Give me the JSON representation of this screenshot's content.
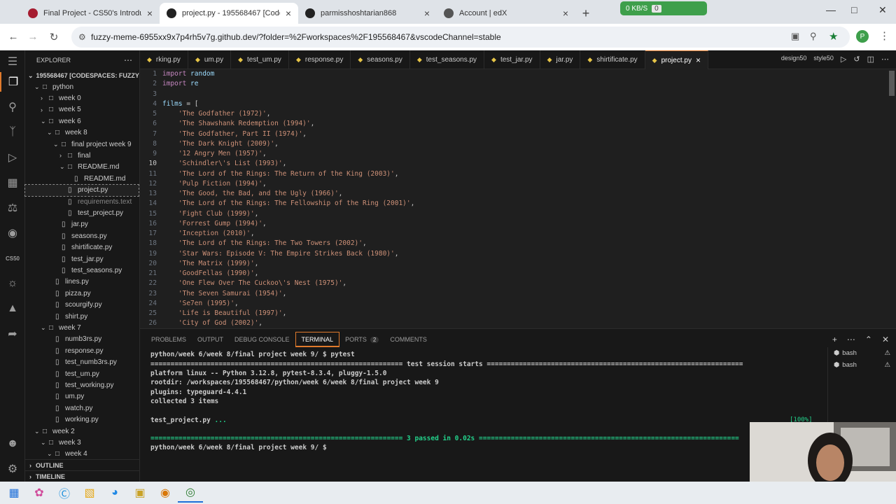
{
  "browser": {
    "tabs": [
      {
        "title": "Final Project - CS50's Introducti",
        "color": "#a51c30",
        "active": false
      },
      {
        "title": "project.py - 195568467 [Codesp",
        "color": "#222222",
        "active": true
      },
      {
        "title": "parmisshoshtarian868",
        "color": "#222222",
        "active": false
      },
      {
        "title": "Account | edX",
        "color": "#555555",
        "active": false
      }
    ],
    "net_speed": "0 KB/S",
    "net_count": "0",
    "url": "fuzzy-meme-6955xx9x7p4rh5v7g.github.dev/?folder=%2Fworkspaces%2F195568467&vscodeChannel=stable",
    "profile_initial": "P"
  },
  "activity": {
    "cs50_label": "CS50"
  },
  "explorer": {
    "title": "EXPLORER",
    "root": "195568467 [CODESPACES: FUZZY M...",
    "outline": "OUTLINE",
    "timeline": "TIMELINE",
    "tree": [
      {
        "label": "python",
        "type": "folder",
        "open": true,
        "indent": 1
      },
      {
        "label": "week 0",
        "type": "folder",
        "open": false,
        "indent": 2
      },
      {
        "label": "week 5",
        "type": "folder",
        "open": false,
        "indent": 2
      },
      {
        "label": "week 6",
        "type": "folder",
        "open": true,
        "indent": 2
      },
      {
        "label": "week 8",
        "type": "folder",
        "open": true,
        "indent": 3
      },
      {
        "label": "final project week 9",
        "type": "folder",
        "open": true,
        "indent": 4
      },
      {
        "label": "final",
        "type": "folder",
        "open": false,
        "indent": 5
      },
      {
        "label": "README.md",
        "type": "folder",
        "open": true,
        "indent": 5
      },
      {
        "label": "README.md",
        "type": "file",
        "indent": 6
      },
      {
        "label": "project.py",
        "type": "file",
        "indent": 5,
        "selected": true
      },
      {
        "label": "requirements.text",
        "type": "file",
        "indent": 5,
        "dim": true
      },
      {
        "label": "test_project.py",
        "type": "file",
        "indent": 5
      },
      {
        "label": "jar.py",
        "type": "file",
        "indent": 4
      },
      {
        "label": "seasons.py",
        "type": "file",
        "indent": 4
      },
      {
        "label": "shirtificate.py",
        "type": "file",
        "indent": 4
      },
      {
        "label": "test_jar.py",
        "type": "file",
        "indent": 4
      },
      {
        "label": "test_seasons.py",
        "type": "file",
        "indent": 4
      },
      {
        "label": "lines.py",
        "type": "file",
        "indent": 3
      },
      {
        "label": "pizza.py",
        "type": "file",
        "indent": 3
      },
      {
        "label": "scourgify.py",
        "type": "file",
        "indent": 3
      },
      {
        "label": "shirt.py",
        "type": "file",
        "indent": 3
      },
      {
        "label": "week 7",
        "type": "folder",
        "open": true,
        "indent": 2
      },
      {
        "label": "numb3rs.py",
        "type": "file",
        "indent": 3
      },
      {
        "label": "response.py",
        "type": "file",
        "indent": 3
      },
      {
        "label": "test_numb3rs.py",
        "type": "file",
        "indent": 3
      },
      {
        "label": "test_um.py",
        "type": "file",
        "indent": 3
      },
      {
        "label": "test_working.py",
        "type": "file",
        "indent": 3
      },
      {
        "label": "um.py",
        "type": "file",
        "indent": 3
      },
      {
        "label": "watch.py",
        "type": "file",
        "indent": 3
      },
      {
        "label": "working.py",
        "type": "file",
        "indent": 3
      },
      {
        "label": "week 2",
        "type": "folder",
        "open": true,
        "indent": 1
      },
      {
        "label": "week 3",
        "type": "folder",
        "open": true,
        "indent": 2
      },
      {
        "label": "week 4",
        "type": "folder",
        "open": true,
        "indent": 3
      }
    ]
  },
  "editor_tabs": [
    {
      "label": "rking.py",
      "active": false
    },
    {
      "label": "um.py",
      "active": false
    },
    {
      "label": "test_um.py",
      "active": false
    },
    {
      "label": "response.py",
      "active": false
    },
    {
      "label": "seasons.py",
      "active": false
    },
    {
      "label": "test_seasons.py",
      "active": false
    },
    {
      "label": "test_jar.py",
      "active": false
    },
    {
      "label": "jar.py",
      "active": false
    },
    {
      "label": "shirtificate.py",
      "active": false
    },
    {
      "label": "project.py",
      "active": true
    }
  ],
  "editor_tools": [
    "design50",
    "style50"
  ],
  "code": [
    {
      "n": "1",
      "tokens": [
        {
          "t": "import",
          "c": "kw"
        },
        {
          "t": " random",
          "c": "tx"
        }
      ]
    },
    {
      "n": "2",
      "tokens": [
        {
          "t": "import",
          "c": "kw"
        },
        {
          "t": " re",
          "c": "tx"
        }
      ]
    },
    {
      "n": "3",
      "tokens": []
    },
    {
      "n": "4",
      "tokens": [
        {
          "t": "films",
          "c": "tx"
        },
        {
          "t": " = [",
          "c": "pu"
        }
      ]
    },
    {
      "n": "5",
      "tokens": [
        {
          "t": "    'The Godfather (1972)'",
          "c": "st"
        },
        {
          "t": ",",
          "c": "pu"
        }
      ]
    },
    {
      "n": "6",
      "tokens": [
        {
          "t": "    'The Shawshank Redemption (1994)'",
          "c": "st"
        },
        {
          "t": ",",
          "c": "pu"
        }
      ]
    },
    {
      "n": "7",
      "tokens": [
        {
          "t": "    'The Godfather, Part II (1974)'",
          "c": "st"
        },
        {
          "t": ",",
          "c": "pu"
        }
      ]
    },
    {
      "n": "8",
      "tokens": [
        {
          "t": "    'The Dark Knight (2009)'",
          "c": "st"
        },
        {
          "t": ",",
          "c": "pu"
        }
      ]
    },
    {
      "n": "9",
      "tokens": [
        {
          "t": "    '12 Angry Men (1957)'",
          "c": "st"
        },
        {
          "t": ",",
          "c": "pu"
        }
      ]
    },
    {
      "n": "10",
      "cur": true,
      "tokens": [
        {
          "t": "    'Schindler\\'s List (1993)'",
          "c": "st"
        },
        {
          "t": ",",
          "c": "pu"
        }
      ]
    },
    {
      "n": "11",
      "tokens": [
        {
          "t": "    'The Lord of the Rings: The Return of the King (2003)'",
          "c": "st"
        },
        {
          "t": ",",
          "c": "pu"
        }
      ]
    },
    {
      "n": "12",
      "tokens": [
        {
          "t": "    'Pulp Fiction (1994)'",
          "c": "st"
        },
        {
          "t": ",",
          "c": "pu"
        }
      ]
    },
    {
      "n": "13",
      "tokens": [
        {
          "t": "    'The Good, the Bad, and the Ugly (1966)'",
          "c": "st"
        },
        {
          "t": ",",
          "c": "pu"
        }
      ]
    },
    {
      "n": "14",
      "tokens": [
        {
          "t": "    'The Lord of the Rings: The Fellowship of the Ring (2001)'",
          "c": "st"
        },
        {
          "t": ",",
          "c": "pu"
        }
      ]
    },
    {
      "n": "15",
      "tokens": [
        {
          "t": "    'Fight Club (1999)'",
          "c": "st"
        },
        {
          "t": ",",
          "c": "pu"
        }
      ]
    },
    {
      "n": "16",
      "tokens": [
        {
          "t": "    'Forrest Gump (1994)'",
          "c": "st"
        },
        {
          "t": ",",
          "c": "pu"
        }
      ]
    },
    {
      "n": "17",
      "tokens": [
        {
          "t": "    'Inception (2010)'",
          "c": "st"
        },
        {
          "t": ",",
          "c": "pu"
        }
      ]
    },
    {
      "n": "18",
      "tokens": [
        {
          "t": "    'The Lord of the Rings: The Two Towers (2002)'",
          "c": "st"
        },
        {
          "t": ",",
          "c": "pu"
        }
      ]
    },
    {
      "n": "19",
      "tokens": [
        {
          "t": "    'Star Wars: Episode V: The Empire Strikes Back (1980)'",
          "c": "st"
        },
        {
          "t": ",",
          "c": "pu"
        }
      ]
    },
    {
      "n": "20",
      "tokens": [
        {
          "t": "    'The Matrix (1999)'",
          "c": "st"
        },
        {
          "t": ",",
          "c": "pu"
        }
      ]
    },
    {
      "n": "21",
      "tokens": [
        {
          "t": "    'GoodFellas (1990)'",
          "c": "st"
        },
        {
          "t": ",",
          "c": "pu"
        }
      ]
    },
    {
      "n": "22",
      "tokens": [
        {
          "t": "    'One Flew Over The Cuckoo\\'s Nest (1975)'",
          "c": "st"
        },
        {
          "t": ",",
          "c": "pu"
        }
      ]
    },
    {
      "n": "23",
      "tokens": [
        {
          "t": "    'The Seven Samurai (1954)'",
          "c": "st"
        },
        {
          "t": ",",
          "c": "pu"
        }
      ]
    },
    {
      "n": "24",
      "tokens": [
        {
          "t": "    'Se7en (1995)'",
          "c": "st"
        },
        {
          "t": ",",
          "c": "pu"
        }
      ]
    },
    {
      "n": "25",
      "tokens": [
        {
          "t": "    'Life is Beautiful (1997)'",
          "c": "st"
        },
        {
          "t": ",",
          "c": "pu"
        }
      ]
    },
    {
      "n": "26",
      "tokens": [
        {
          "t": "    'City of God (2002)'",
          "c": "st"
        },
        {
          "t": ",",
          "c": "pu"
        }
      ]
    }
  ],
  "panel": {
    "tabs": [
      {
        "label": "PROBLEMS",
        "active": false
      },
      {
        "label": "OUTPUT",
        "active": false
      },
      {
        "label": "DEBUG CONSOLE",
        "active": false
      },
      {
        "label": "TERMINAL",
        "active": true
      },
      {
        "label": "PORTS",
        "active": false,
        "badge": "2"
      },
      {
        "label": "COMMENTS",
        "active": false
      }
    ],
    "terminals": [
      "bash",
      "bash"
    ]
  },
  "terminal": [
    {
      "parts": [
        {
          "t": "python/week 6/week 8/final project week 9/ $ pytest"
        }
      ]
    },
    {
      "parts": [
        {
          "t": "=============================================================== test session starts ================================================================"
        }
      ]
    },
    {
      "parts": [
        {
          "t": "platform linux -- Python 3.12.8, pytest-8.3.4, pluggy-1.5.0"
        }
      ]
    },
    {
      "parts": [
        {
          "t": "rootdir: /workspaces/195568467/python/week 6/week 8/final project week 9"
        }
      ]
    },
    {
      "parts": [
        {
          "t": "plugins: typeguard-4.4.1"
        }
      ]
    },
    {
      "parts": [
        {
          "t": "collected 3 items"
        }
      ]
    },
    {
      "parts": []
    },
    {
      "parts": [
        {
          "t": "test_project.py "
        },
        {
          "t": "...",
          "g": true
        }
      ]
    },
    {
      "parts": []
    },
    {
      "parts": [
        {
          "t": "=============================================================== 3 passed in 0.02s =================================================================",
          "g": true
        }
      ]
    },
    {
      "parts": [
        {
          "t": "python/week 6/week 8/final project week 9/ $ "
        }
      ]
    }
  ],
  "terminal_progress": "[100%]"
}
